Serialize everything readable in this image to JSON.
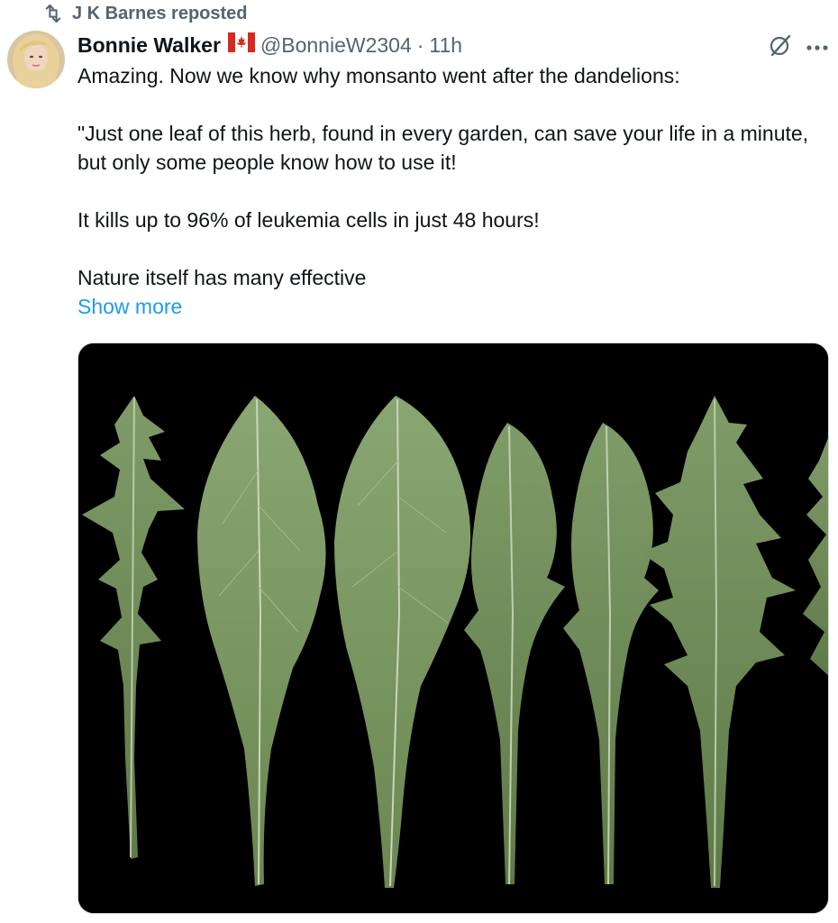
{
  "repost": {
    "label": "J K Barnes reposted",
    "icon": "repost-icon"
  },
  "tweet": {
    "author": {
      "display_name": "Bonnie Walker",
      "flag": "canada-flag",
      "handle": "@BonnieW2304",
      "separator": "·",
      "time": "11h"
    },
    "text_lines": [
      "Amazing. Now we know why monsanto went after the dandelions:",
      "\"Just one leaf of this herb, found in every garden, can save your life in a minute, but only some people know how to use it!",
      "It kills up to 96% of leukemia cells in just 48 hours!",
      "Nature itself has many effective"
    ],
    "show_more": "Show more",
    "media": {
      "icon": "dandelion-leaves-image"
    }
  },
  "colors": {
    "text": "#0f1419",
    "muted": "#536471",
    "link": "#1d9bf0",
    "leaf": "#6c8a55",
    "background": "#ffffff"
  }
}
